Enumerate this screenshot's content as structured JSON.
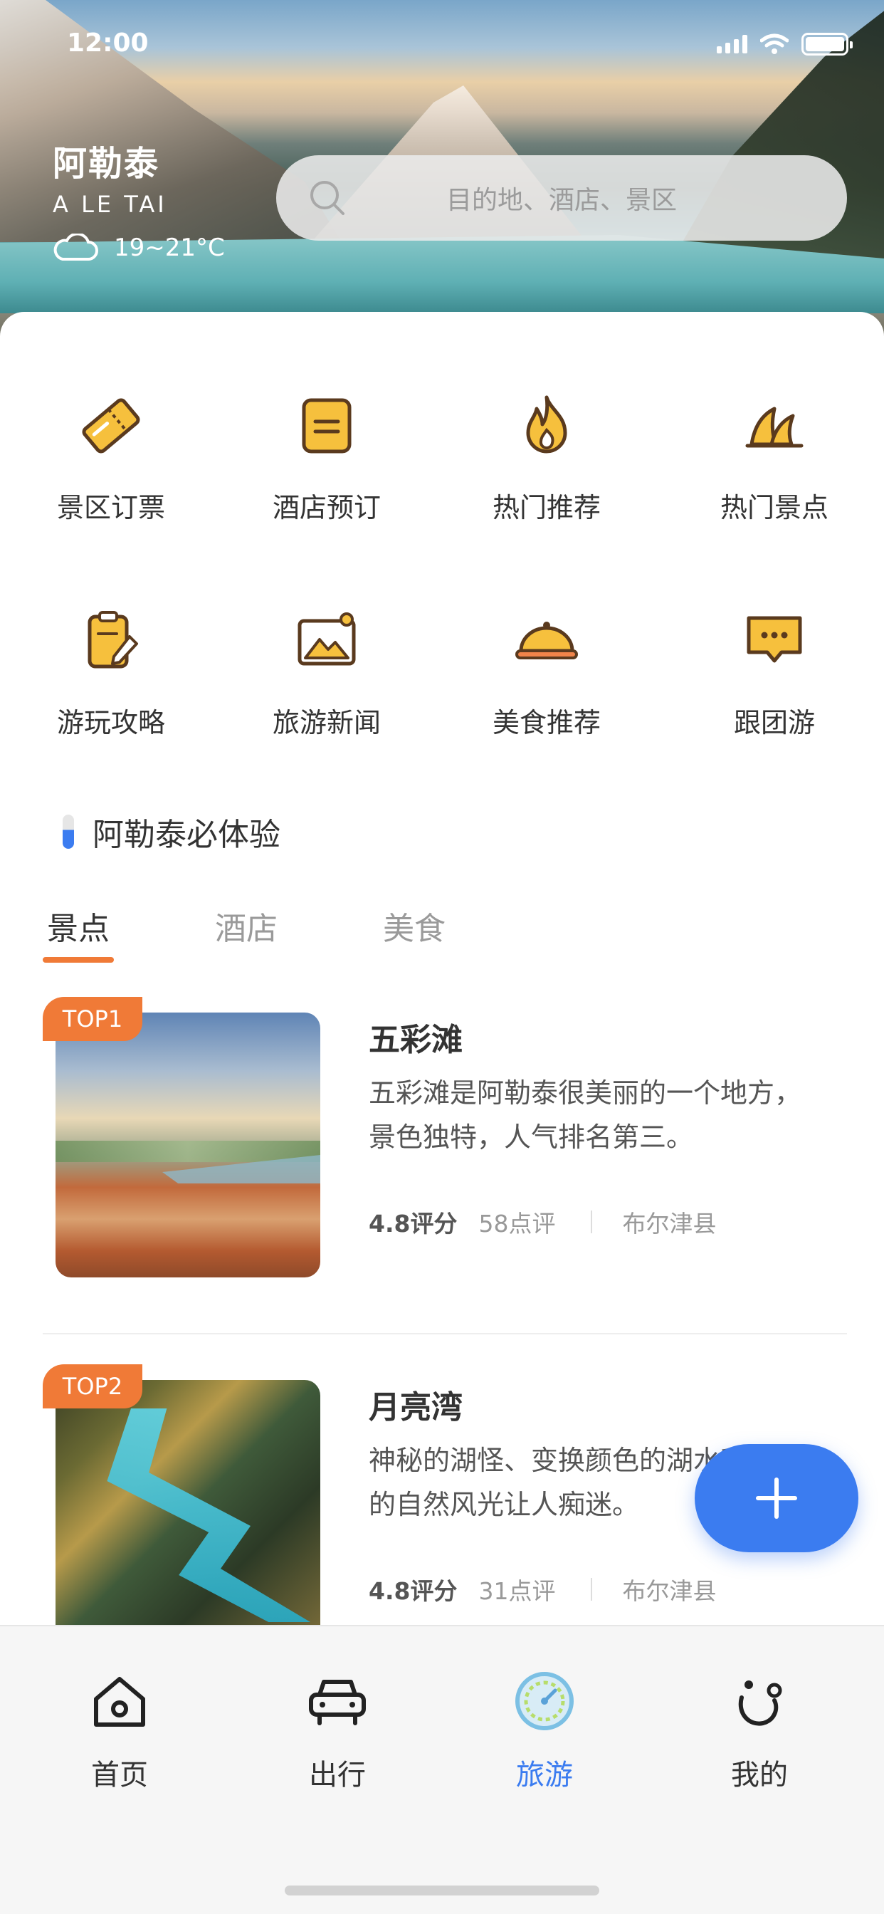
{
  "status_bar": {
    "time": "12:00"
  },
  "header": {
    "city_name": "阿勒泰",
    "city_pinyin": "A LE TAI",
    "temperature": "19~21°C",
    "search_placeholder": "目的地、酒店、景区"
  },
  "shortcuts": [
    {
      "label": "景区订票",
      "icon": "ticket-icon"
    },
    {
      "label": "酒店预订",
      "icon": "hotel-icon"
    },
    {
      "label": "热门推荐",
      "icon": "fire-icon"
    },
    {
      "label": "热门景点",
      "icon": "opera-house-icon"
    },
    {
      "label": "游玩攻略",
      "icon": "clipboard-pen-icon"
    },
    {
      "label": "旅游新闻",
      "icon": "picture-icon"
    },
    {
      "label": "美食推荐",
      "icon": "food-cloche-icon"
    },
    {
      "label": "跟团游",
      "icon": "chat-bubble-icon"
    }
  ],
  "section": {
    "title": "阿勒泰必体验"
  },
  "tabs": [
    {
      "label": "景点",
      "active": true
    },
    {
      "label": "酒店",
      "active": false
    },
    {
      "label": "美食",
      "active": false
    }
  ],
  "list": [
    {
      "badge": "TOP1",
      "title": "五彩滩",
      "desc": "五彩滩是阿勒泰很美丽的一个地方，景色独特，人气排名第三。",
      "score": "4.8评分",
      "reviews": "58点评",
      "location": "布尔津县"
    },
    {
      "badge": "TOP2",
      "title": "月亮湾",
      "desc": "神秘的湖怪、变换颜色的湖水和炫目的自然风光让人痴迷。",
      "score": "4.8评分",
      "reviews": "31点评",
      "location": "布尔津县"
    }
  ],
  "bottom_nav": [
    {
      "label": "首页",
      "icon": "home-icon",
      "active": false
    },
    {
      "label": "出行",
      "icon": "car-icon",
      "active": false
    },
    {
      "label": "旅游",
      "icon": "compass-icon",
      "active": true
    },
    {
      "label": "我的",
      "icon": "profile-icon",
      "active": false
    }
  ],
  "colors": {
    "accent": "#3b7cf0",
    "badge": "#f07a37",
    "icon_fill": "#f6c03d",
    "icon_stroke": "#5a3a1e"
  }
}
